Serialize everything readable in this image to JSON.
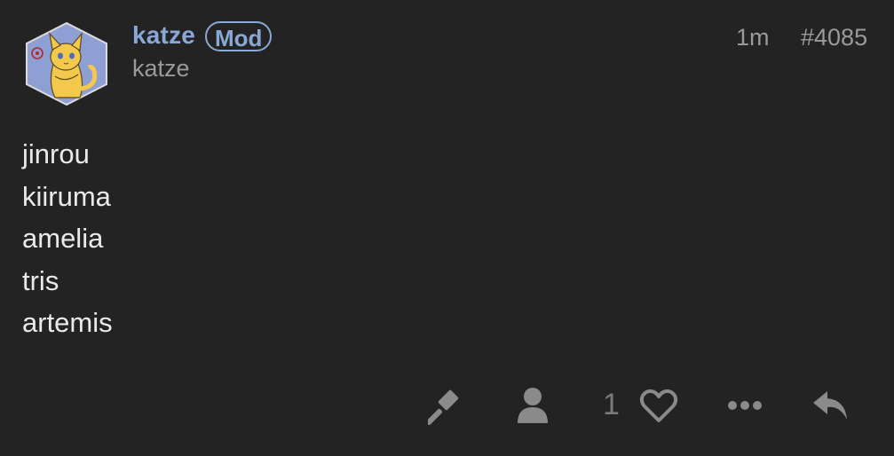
{
  "author": {
    "username": "katze",
    "badge": "Mod",
    "display_name": "katze",
    "avatar_icon": "cat-avatar-icon"
  },
  "meta": {
    "time": "1m",
    "post_number": "#4085"
  },
  "content": {
    "lines": [
      "jinrou",
      "kiiruma",
      "amelia",
      "tris",
      "artemis"
    ]
  },
  "actions": {
    "flag_icon": "gavel-icon",
    "user_icon": "user-icon",
    "like_count": "1",
    "like_icon": "heart-icon",
    "more_icon": "ellipsis-icon",
    "reply_icon": "reply-icon"
  },
  "colors": {
    "background": "#232323",
    "accent": "#8aa8d6",
    "muted": "#9a9a9a",
    "icon": "#8a8a8a"
  }
}
